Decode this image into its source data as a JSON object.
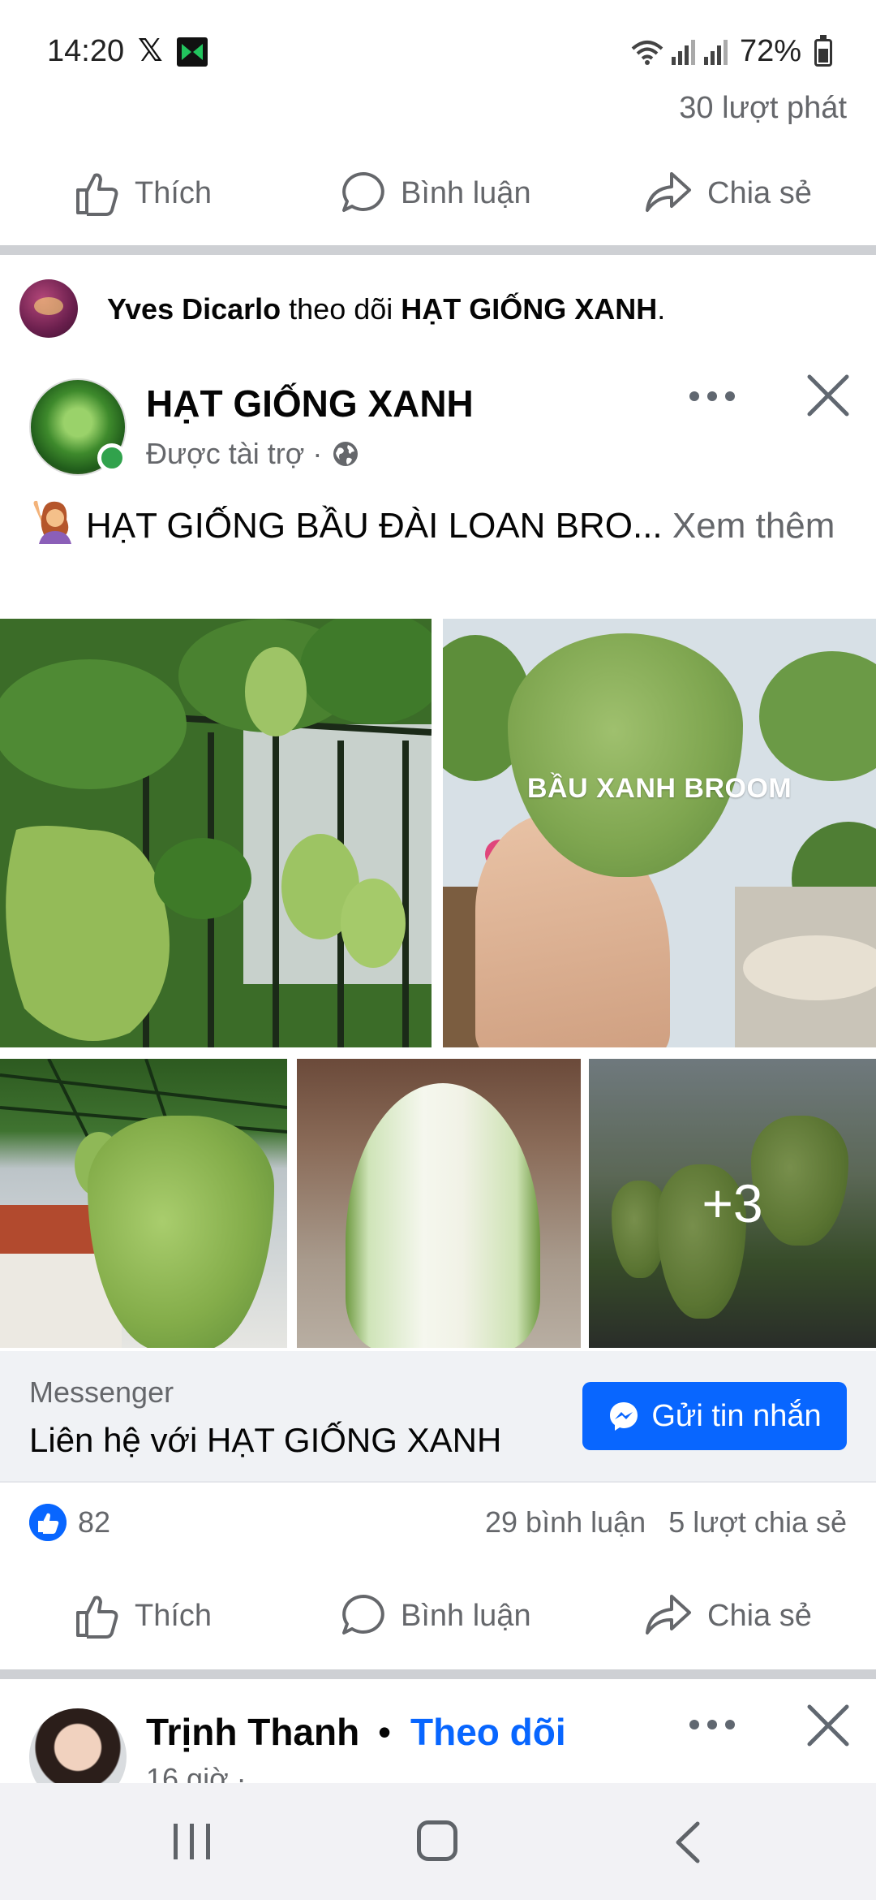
{
  "status_bar": {
    "time": "14:20",
    "x_glyph": "𝕏",
    "battery": "72%"
  },
  "prev_post": {
    "plays": "30 lượt phát",
    "actions": {
      "like": "Thích",
      "comment": "Bình luận",
      "share": "Chia sẻ"
    }
  },
  "notification": {
    "user": "Yves Dicarlo",
    "verb": " theo dõi ",
    "page": "HẠT GIỐNG XANH",
    "end": "."
  },
  "post": {
    "page_name": "HẠT GIỐNG XANH",
    "sponsored": "Được tài trợ ·",
    "text": "HẠT GIỐNG BẦU ĐÀI LOAN BRO...",
    "see_more": " Xem thêm",
    "photo_label": "BẦU XANH BROOM",
    "more_photos": "+3",
    "cta": {
      "label": "Messenger",
      "title": "Liên hệ với HẠT GIỐNG XANH",
      "button": "Gửi tin nhắn"
    },
    "reactions": {
      "count": "82",
      "comments": "29 bình luận",
      "shares": "5 lượt chia sẻ"
    },
    "actions": {
      "like": "Thích",
      "comment": "Bình luận",
      "share": "Chia sẻ"
    }
  },
  "next_post": {
    "name": "Trịnh Thanh",
    "separator": "•",
    "follow": "Theo dõi",
    "sub": "16 giờ ·"
  },
  "colors": {
    "accent": "#0866ff",
    "secondary_text": "#65676b",
    "online": "#31a24c"
  },
  "icons": [
    "x-logo-icon",
    "app-icon",
    "wifi-icon",
    "signal-icon",
    "battery-icon",
    "thumbs-up-icon",
    "comment-icon",
    "share-icon",
    "globe-icon",
    "more-icon",
    "close-icon",
    "messenger-icon",
    "like-reaction-icon",
    "nav-recents-icon",
    "nav-home-icon",
    "nav-back-icon"
  ]
}
